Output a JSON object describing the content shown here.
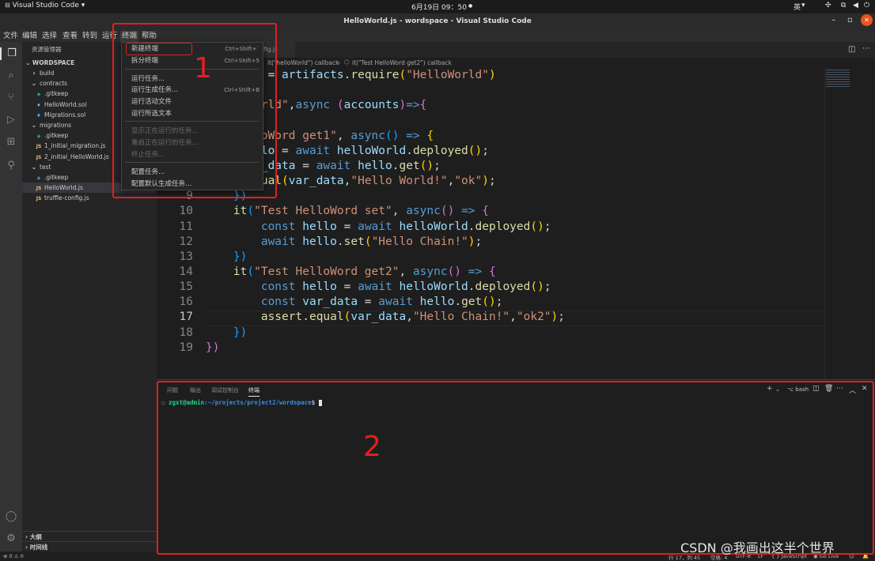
{
  "system_bar": {
    "app_name": "Visual Studio Code",
    "clock": "6月19日  09：50",
    "input_method": "英",
    "colors": {
      "background": "#1b1b1b"
    }
  },
  "title_bar": {
    "title": "HelloWorld.js - wordspace - Visual Studio Code",
    "minimize": "–",
    "maximize": "▫",
    "close": "✕"
  },
  "menu": [
    "文件",
    "编辑",
    "选择",
    "查看",
    "转到",
    "运行",
    "终端",
    "帮助"
  ],
  "terminal_menu": {
    "items": [
      {
        "label": "新建终端",
        "shortcut": "Ctrl+Shift+`",
        "disabled": false
      },
      {
        "label": "拆分终端",
        "shortcut": "Ctrl+Shift+5",
        "disabled": false
      },
      {
        "label": "运行任务...",
        "shortcut": "",
        "disabled": false
      },
      {
        "label": "运行生成任务...",
        "shortcut": "Ctrl+Shift+B",
        "disabled": false
      },
      {
        "label": "运行活动文件",
        "shortcut": "",
        "disabled": false
      },
      {
        "label": "运行所选文本",
        "shortcut": "",
        "disabled": false
      },
      {
        "label": "显示正在运行的任务...",
        "shortcut": "",
        "disabled": true
      },
      {
        "label": "重启正在运行的任务...",
        "shortcut": "",
        "disabled": true
      },
      {
        "label": "终止任务...",
        "shortcut": "",
        "disabled": true
      },
      {
        "label": "配置任务...",
        "shortcut": "",
        "disabled": false
      },
      {
        "label": "配置默认生成任务...",
        "shortcut": "",
        "disabled": false
      }
    ]
  },
  "explorer": {
    "header": "资源管理器",
    "workspace": "WORDSPACE",
    "tree": [
      {
        "name": "build",
        "kind": "folder-collapsed"
      },
      {
        "name": "contracts",
        "kind": "folder-open"
      },
      {
        "name": ".gitkeep",
        "kind": "git"
      },
      {
        "name": "HelloWorld.sol",
        "kind": "sol"
      },
      {
        "name": "Migrations.sol",
        "kind": "sol"
      },
      {
        "name": "migrations",
        "kind": "folder-open"
      },
      {
        "name": ".gitkeep",
        "kind": "git"
      },
      {
        "name": "1_initial_migration.js",
        "kind": "js"
      },
      {
        "name": "2_initial_HelloWorld.js",
        "kind": "js"
      },
      {
        "name": "test",
        "kind": "folder-open"
      },
      {
        "name": ".gitkeep",
        "kind": "git"
      },
      {
        "name": "HelloWorld.js",
        "kind": "js",
        "selected": true
      },
      {
        "name": "truffle-config.js",
        "kind": "js"
      }
    ],
    "outline": "大纲",
    "timeline": "时间线"
  },
  "editor": {
    "tab_partial": "fig.js",
    "breadcrumb_prefix": "it(\"helloWorld\") callback",
    "breadcrumb_sep": "›",
    "breadcrumb_current": "it(\"Test HelloWord get2\") callback",
    "current_line": 17,
    "lines": [
      {
        "n": "",
        "tokens": [
          [
            "var",
            "lloWorld"
          ],
          [
            "",
            " = "
          ],
          [
            "var",
            "artifacts"
          ],
          [
            "",
            "."
          ],
          [
            "fn",
            "require"
          ],
          [
            "br1",
            "("
          ],
          [
            "str",
            "\"HelloWorld\""
          ],
          [
            "br1",
            ")"
          ]
        ]
      },
      {
        "n": "",
        "tokens": []
      },
      {
        "n": "",
        "tokens": [
          [
            "str",
            "\"helloWorld\""
          ],
          [
            "",
            ","
          ],
          [
            "kw",
            "async"
          ],
          [
            "",
            " "
          ],
          [
            "br2",
            "("
          ],
          [
            "var",
            "accounts"
          ],
          [
            "br2",
            ")"
          ],
          [
            "kw",
            "=>"
          ],
          [
            "br2",
            "{"
          ]
        ]
      },
      {
        "n": "",
        "tokens": [
          [
            "var",
            "ar_data"
          ]
        ]
      },
      {
        "n": "",
        "tokens": [
          [
            "str",
            "est HelloWord get1\""
          ],
          [
            "",
            ", "
          ],
          [
            "kw",
            "async"
          ],
          [
            "br3",
            "()"
          ],
          [
            "",
            " "
          ],
          [
            "kw",
            "=>"
          ],
          [
            "",
            " "
          ],
          [
            "br1",
            "{"
          ]
        ]
      },
      {
        "n": "",
        "tokens": [
          [
            "kw",
            "onst"
          ],
          [
            "",
            " "
          ],
          [
            "var",
            "hello"
          ],
          [
            "",
            " = "
          ],
          [
            "kw",
            "await"
          ],
          [
            "",
            " "
          ],
          [
            "var",
            "helloWorld"
          ],
          [
            "",
            "."
          ],
          [
            "fn",
            "deployed"
          ],
          [
            "br1",
            "()"
          ],
          [
            "",
            ";"
          ]
        ]
      },
      {
        "n": "",
        "tokens": [
          [
            "kw",
            "onst"
          ],
          [
            "",
            " "
          ],
          [
            "var",
            "var_data"
          ],
          [
            "",
            " = "
          ],
          [
            "kw",
            "await"
          ],
          [
            "",
            " "
          ],
          [
            "var",
            "hello"
          ],
          [
            "",
            "."
          ],
          [
            "fn",
            "get"
          ],
          [
            "br1",
            "()"
          ],
          [
            "",
            ";"
          ]
        ]
      },
      {
        "n": "",
        "tokens": [
          [
            "fn",
            "ssert"
          ],
          [
            "",
            "."
          ],
          [
            "fn",
            "equal"
          ],
          [
            "br1",
            "("
          ],
          [
            "var",
            "var_data"
          ],
          [
            "",
            ","
          ],
          [
            "str",
            "\"Hello World!\""
          ],
          [
            "",
            ","
          ],
          [
            "str",
            "\"ok\""
          ],
          [
            "br1",
            ")"
          ],
          [
            "",
            ";"
          ]
        ]
      },
      {
        "n": "9",
        "tokens": [
          [
            "",
            "    "
          ],
          [
            "br3",
            "})"
          ]
        ]
      },
      {
        "n": "10",
        "tokens": [
          [
            "",
            "    "
          ],
          [
            "fn",
            "it"
          ],
          [
            "br3",
            "("
          ],
          [
            "str",
            "\"Test HelloWord set\""
          ],
          [
            "",
            ", "
          ],
          [
            "kw",
            "async"
          ],
          [
            "br2",
            "()"
          ],
          [
            "",
            " "
          ],
          [
            "kw",
            "=>"
          ],
          [
            "",
            " "
          ],
          [
            "br2",
            "{"
          ]
        ]
      },
      {
        "n": "11",
        "tokens": [
          [
            "",
            "        "
          ],
          [
            "kw",
            "const"
          ],
          [
            "",
            " "
          ],
          [
            "var",
            "hello"
          ],
          [
            "",
            " = "
          ],
          [
            "kw",
            "await"
          ],
          [
            "",
            " "
          ],
          [
            "var",
            "helloWorld"
          ],
          [
            "",
            "."
          ],
          [
            "fn",
            "deployed"
          ],
          [
            "br1",
            "()"
          ],
          [
            "",
            ";"
          ]
        ]
      },
      {
        "n": "12",
        "tokens": [
          [
            "",
            "        "
          ],
          [
            "kw",
            "await"
          ],
          [
            "",
            " "
          ],
          [
            "var",
            "hello"
          ],
          [
            "",
            "."
          ],
          [
            "fn",
            "set"
          ],
          [
            "br1",
            "("
          ],
          [
            "str",
            "\"Hello Chain!\""
          ],
          [
            "br1",
            ")"
          ],
          [
            "",
            ";"
          ]
        ]
      },
      {
        "n": "13",
        "tokens": [
          [
            "",
            "    "
          ],
          [
            "br3",
            "})"
          ]
        ]
      },
      {
        "n": "14",
        "tokens": [
          [
            "",
            "    "
          ],
          [
            "fn",
            "it"
          ],
          [
            "br3",
            "("
          ],
          [
            "str",
            "\"Test HelloWord get2\""
          ],
          [
            "",
            ", "
          ],
          [
            "kw",
            "async"
          ],
          [
            "br2",
            "()"
          ],
          [
            "",
            " "
          ],
          [
            "kw",
            "=>"
          ],
          [
            "",
            " "
          ],
          [
            "br2",
            "{"
          ]
        ]
      },
      {
        "n": "15",
        "tokens": [
          [
            "",
            "        "
          ],
          [
            "kw",
            "const"
          ],
          [
            "",
            " "
          ],
          [
            "var",
            "hello"
          ],
          [
            "",
            " = "
          ],
          [
            "kw",
            "await"
          ],
          [
            "",
            " "
          ],
          [
            "var",
            "helloWorld"
          ],
          [
            "",
            "."
          ],
          [
            "fn",
            "deployed"
          ],
          [
            "br1",
            "()"
          ],
          [
            "",
            ";"
          ]
        ]
      },
      {
        "n": "16",
        "tokens": [
          [
            "",
            "        "
          ],
          [
            "kw",
            "const"
          ],
          [
            "",
            " "
          ],
          [
            "var",
            "var_data"
          ],
          [
            "",
            " = "
          ],
          [
            "kw",
            "await"
          ],
          [
            "",
            " "
          ],
          [
            "var",
            "hello"
          ],
          [
            "",
            "."
          ],
          [
            "fn",
            "get"
          ],
          [
            "br1",
            "()"
          ],
          [
            "",
            ";"
          ]
        ]
      },
      {
        "n": "17",
        "tokens": [
          [
            "",
            "        "
          ],
          [
            "fn",
            "assert"
          ],
          [
            "",
            "."
          ],
          [
            "fn",
            "equal"
          ],
          [
            "br1",
            "("
          ],
          [
            "var",
            "var_data"
          ],
          [
            "",
            ","
          ],
          [
            "str",
            "\"Hello Chain!\""
          ],
          [
            "",
            ","
          ],
          [
            "str",
            "\"ok2\""
          ],
          [
            "br1",
            ")"
          ],
          [
            "",
            ";"
          ]
        ]
      },
      {
        "n": "18",
        "tokens": [
          [
            "",
            "    "
          ],
          [
            "br3",
            "})"
          ]
        ]
      },
      {
        "n": "19",
        "tokens": [
          [
            "br2",
            "})"
          ]
        ]
      }
    ]
  },
  "panel": {
    "tabs": [
      "问题",
      "输出",
      "调试控制台",
      "终端"
    ],
    "active_tab": "终端",
    "shell": "bash",
    "prompt_user": "zgxt@admin",
    "prompt_path": ":~/projects/project2/wordspace",
    "prompt_end": "$"
  },
  "status_bar": {
    "left": "⊗ 0  ⚠ 0",
    "position": "行 17，列 45",
    "spaces": "空格: 4",
    "encoding": "UTF-8",
    "eol": "LF",
    "language": "{ } JavaScript",
    "golive": "Go Live"
  },
  "annotations": {
    "label_1": "1",
    "label_2": "2",
    "color": "#e02020"
  },
  "watermark": "CSDN @我画出这半个世界"
}
